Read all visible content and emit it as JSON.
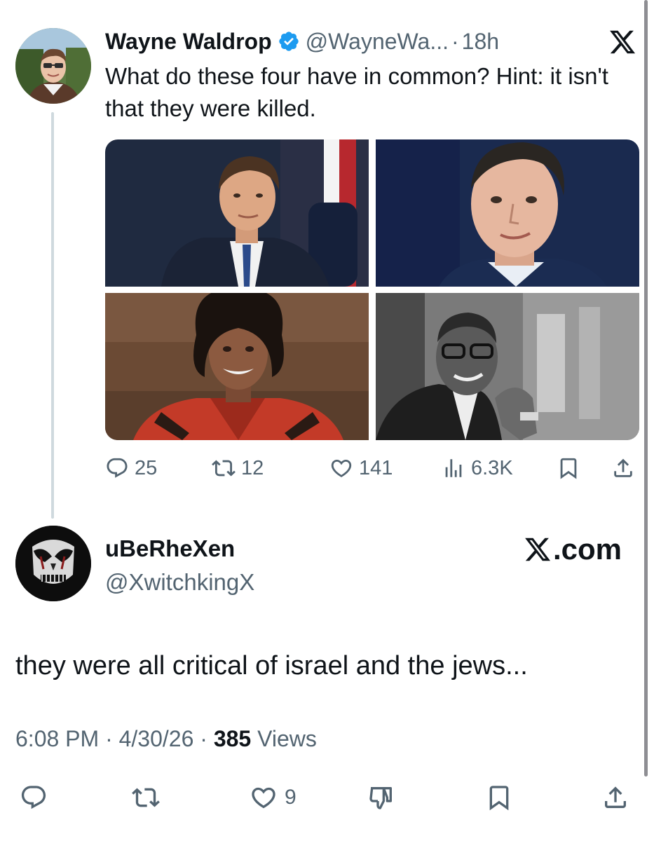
{
  "quoted_tweet": {
    "author_name": "Wayne Waldrop",
    "author_handle": "@WayneWa...",
    "separator": "·",
    "time_ago": "18h",
    "text": "What do these four have in common? Hint: it isn't that they were killed.",
    "media_count": 4,
    "stats": {
      "replies": "25",
      "reposts": "12",
      "likes": "141",
      "views": "6.3K"
    }
  },
  "reply": {
    "author_name": "uBeRheXen",
    "author_handle": "@XwitchkingX",
    "source_label": ".com",
    "text": "they were all critical of israel and the jews...",
    "time": "6:08 PM",
    "date": "4/30/26",
    "views_count": "385",
    "views_label": "Views",
    "separator": "·",
    "likes": "9"
  },
  "icons": {
    "verified": "verified-badge-icon",
    "brand": "x-logo-icon",
    "reply": "reply-icon",
    "repost": "repost-icon",
    "like": "heart-icon",
    "views": "views-chart-icon",
    "bookmark": "bookmark-icon",
    "share": "share-icon",
    "dislike": "dislike-icon"
  },
  "colors": {
    "text_primary": "#0f1419",
    "text_secondary": "#536471",
    "verified_blue": "#1d9bf0",
    "thread_line": "#cfd9de",
    "background": "#ffffff"
  }
}
